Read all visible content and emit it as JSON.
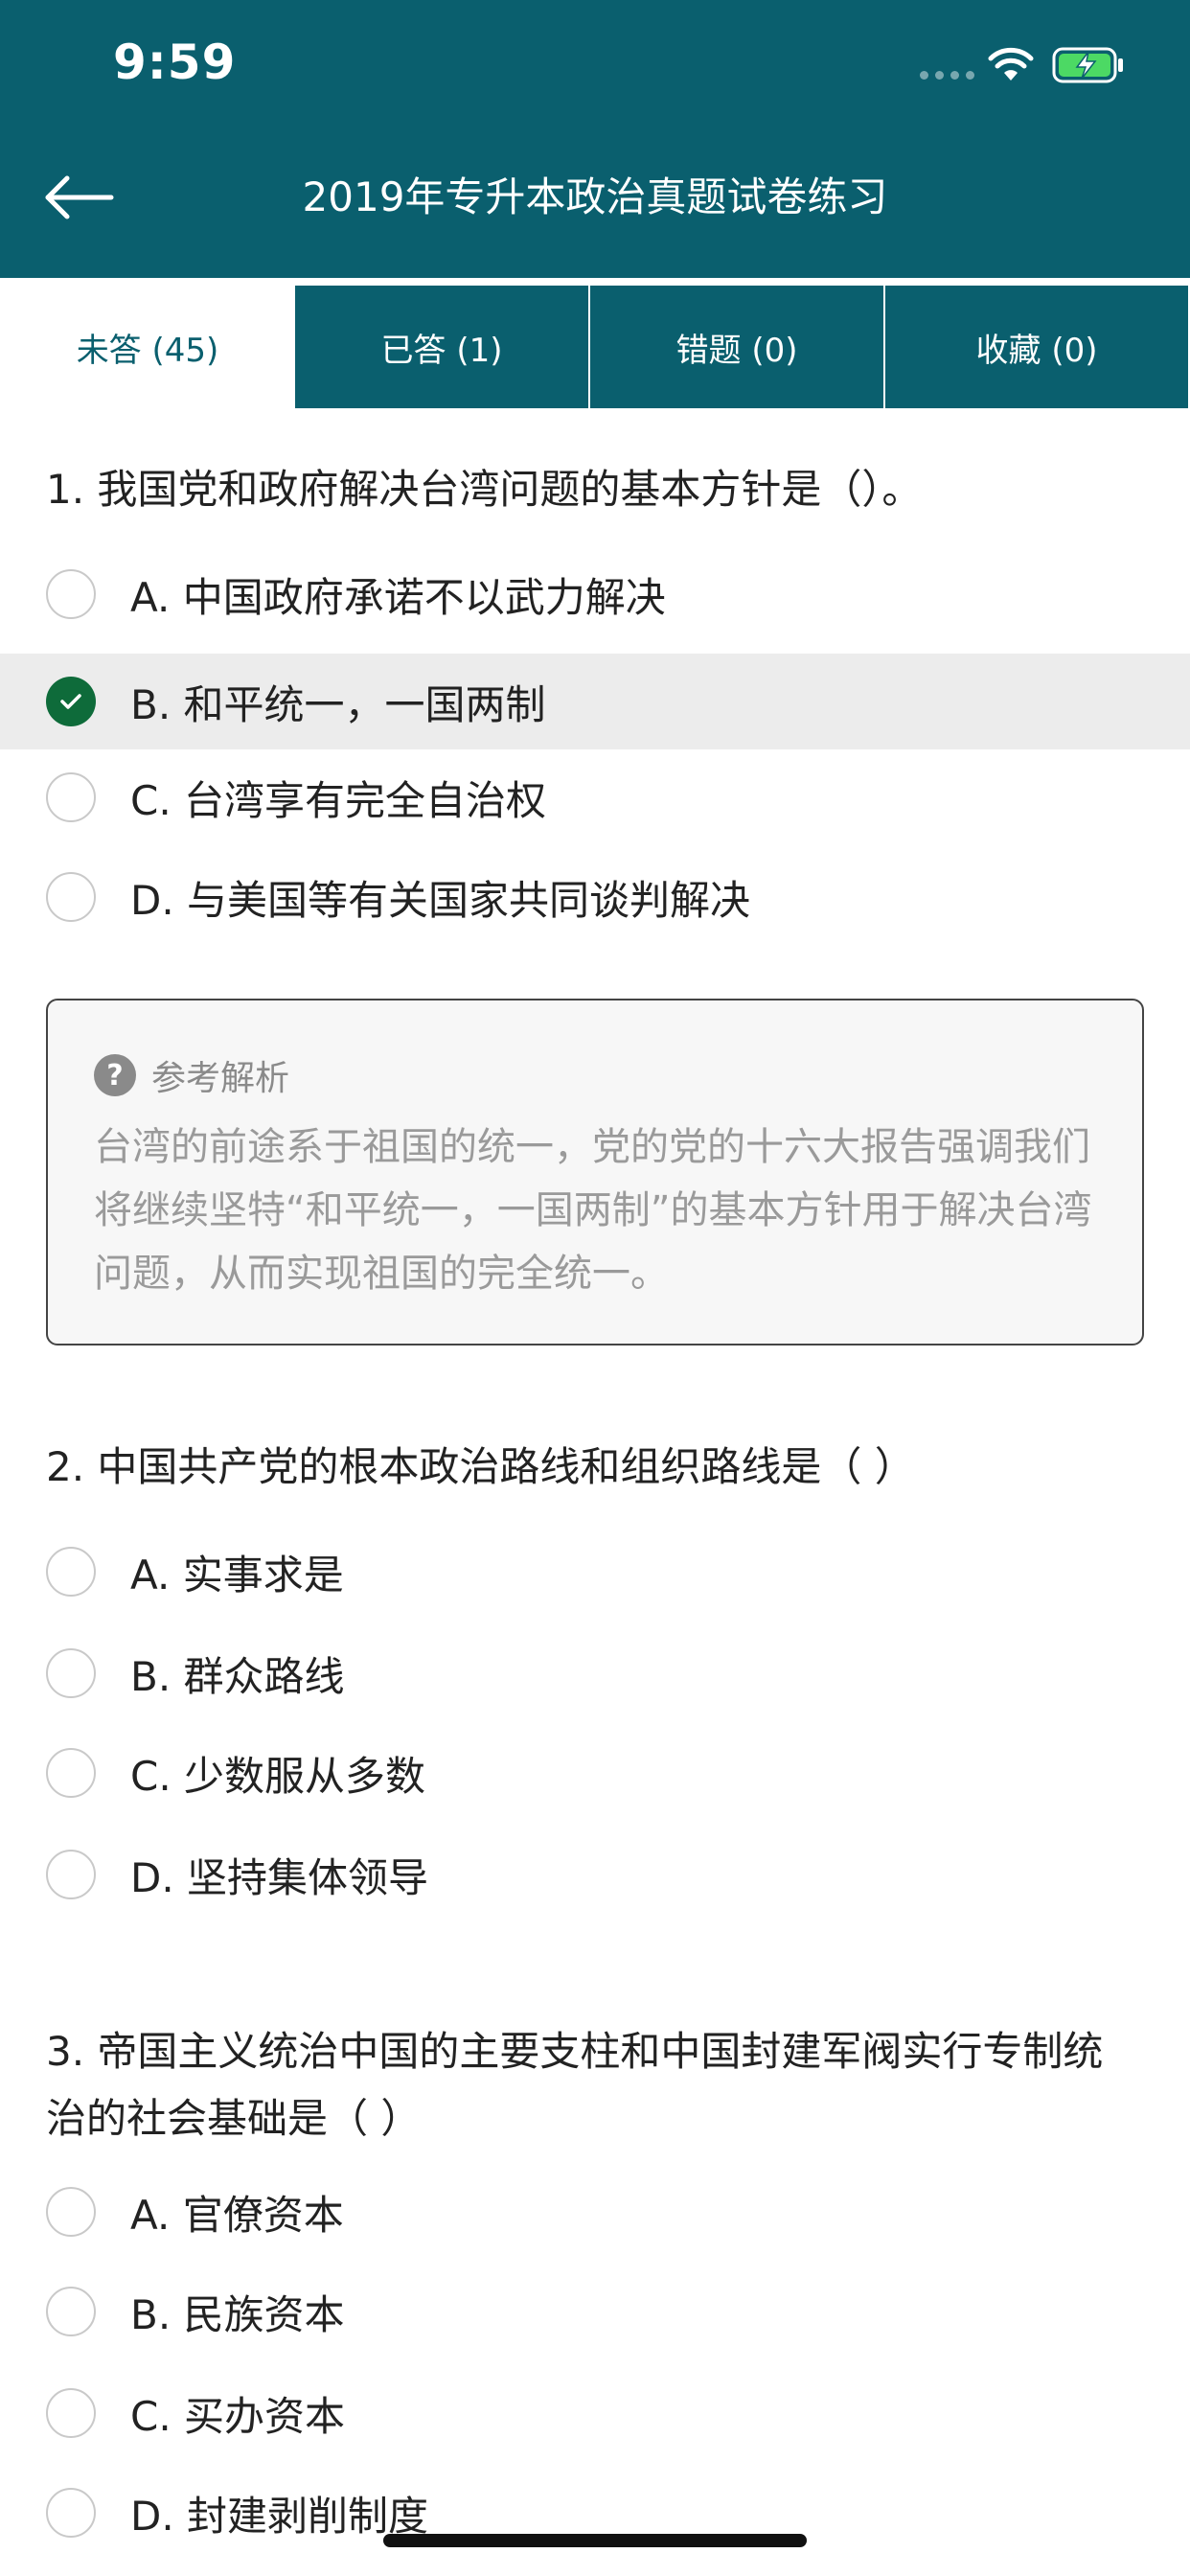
{
  "status": {
    "time": "9:59"
  },
  "header": {
    "title": "2019年专升本政治真题试卷练习",
    "background": "#0a5f6e"
  },
  "tabs": [
    {
      "label": "未答 (45)",
      "active": true
    },
    {
      "label": "已答 (1)",
      "active": false
    },
    {
      "label": "错题 (0)",
      "active": false
    },
    {
      "label": "收藏 (0)",
      "active": false
    }
  ],
  "questions": [
    {
      "text": "1. 我国党和政府解决台湾问题的基本方针是（）。",
      "options": [
        {
          "text": "A. 中国政府承诺不以武力解决",
          "selected": false
        },
        {
          "text": "B. 和平统一，一国两制",
          "selected": true
        },
        {
          "text": "C. 台湾享有完全自治权",
          "selected": false
        },
        {
          "text": "D. 与美国等有关国家共同谈判解决",
          "selected": false
        }
      ],
      "analysis": {
        "label": "参考解析",
        "text": "台湾的前途系于祖国的统一，党的党的十六大报告强调我们将继续坚特“和平统一，一国两制”的基本方针用于解决台湾问题，从而实现祖国的完全统一。"
      }
    },
    {
      "text": "2. 中国共产党的根本政治路线和组织路线是（ ）",
      "options": [
        {
          "text": "A. 实事求是",
          "selected": false
        },
        {
          "text": "B. 群众路线",
          "selected": false
        },
        {
          "text": "C. 少数服从多数",
          "selected": false
        },
        {
          "text": "D. 坚持集体领导",
          "selected": false
        }
      ]
    },
    {
      "text": "3. 帝国主义统治中国的主要支柱和中国封建军阀实行专制统治的社会基础是（ ）",
      "options": [
        {
          "text": "A. 官僚资本",
          "selected": false
        },
        {
          "text": "B. 民族资本",
          "selected": false
        },
        {
          "text": "C. 买办资本",
          "selected": false
        },
        {
          "text": "D. 封建剥削制度",
          "selected": false
        }
      ]
    }
  ]
}
